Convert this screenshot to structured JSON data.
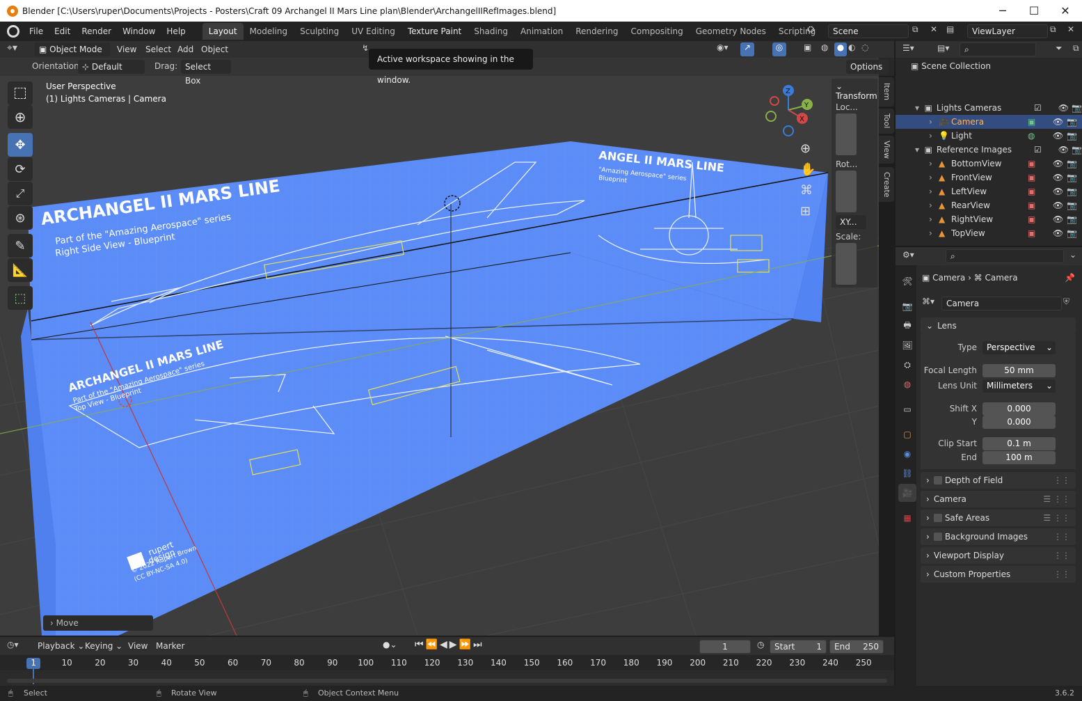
{
  "window": {
    "title": "Blender [C:\\Users\\ruper\\Documents\\Projects - Posters\\Craft 09 Archangel II Mars Line plan\\Blender\\ArchangelIIRefImages.blend]",
    "min": "─",
    "max": "☐",
    "close": "✕"
  },
  "menus": [
    "File",
    "Edit",
    "Render",
    "Window",
    "Help"
  ],
  "workspaces": [
    "Layout",
    "Modeling",
    "Sculpting",
    "UV Editing",
    "Texture Paint",
    "Shading",
    "Animation",
    "Rendering",
    "Compositing",
    "Geometry Nodes",
    "Scripting"
  ],
  "add_workspace": "+",
  "scene": {
    "label": "Scene",
    "viewlayer": "ViewLayer"
  },
  "header": {
    "mode": "Object Mode",
    "view": "View",
    "select": "Select",
    "add": "Add",
    "object": "Object",
    "orientation_label": "Orientation:",
    "orientation": "Default",
    "drag_label": "Drag:",
    "drag": "Select Box",
    "options": "Options"
  },
  "tooltip": "Active workspace showing in the window.",
  "viewport": {
    "line1": "User Perspective",
    "line2": "(1) Lights Cameras | Camera",
    "move_panel": "Move"
  },
  "npanel": {
    "title": "Transform",
    "loc": "Loc...",
    "rot": "Rot...",
    "rotmode": "XY...",
    "scale": "Scale:",
    "tabs": [
      "Item",
      "Tool",
      "View",
      "Create"
    ]
  },
  "outliner": {
    "root": "Scene Collection",
    "rows": [
      {
        "name": "Lights Cameras",
        "indent": 1
      },
      {
        "name": "Camera",
        "indent": 2
      },
      {
        "name": "Light",
        "indent": 2
      },
      {
        "name": "Reference Images",
        "indent": 1
      },
      {
        "name": "BottomView",
        "indent": 2
      },
      {
        "name": "FrontView",
        "indent": 2
      },
      {
        "name": "LeftView",
        "indent": 2
      },
      {
        "name": "RearView",
        "indent": 2
      },
      {
        "name": "RightView",
        "indent": 2
      },
      {
        "name": "TopView",
        "indent": 2
      }
    ]
  },
  "props": {
    "crumb1": "Camera",
    "crumb2": "Camera",
    "datablock": "Camera",
    "lens_panel": "Lens",
    "type_label": "Type",
    "type_val": "Perspective",
    "focal_label": "Focal Length",
    "focal_val": "50 mm",
    "unit_label": "Lens Unit",
    "unit_val": "Millimeters",
    "shiftx_label": "Shift X",
    "shiftx_val": "0.000",
    "shifty_label": "Y",
    "shifty_val": "0.000",
    "clipstart_label": "Clip Start",
    "clipstart_val": "0.1 m",
    "clipend_label": "End",
    "clipend_val": "100 m",
    "panels": [
      "Depth of Field",
      "Camera",
      "Safe Areas",
      "Background Images",
      "Viewport Display",
      "Custom Properties"
    ]
  },
  "timeline": {
    "playback": "Playback",
    "keying": "Keying",
    "view": "View",
    "marker": "Marker",
    "frame": "1",
    "start_label": "Start",
    "start": "1",
    "end_label": "End",
    "end": "250",
    "ticks": [
      "1",
      "10",
      "20",
      "30",
      "40",
      "50",
      "60",
      "70",
      "80",
      "90",
      "100",
      "110",
      "120",
      "130",
      "140",
      "150",
      "160",
      "170",
      "180",
      "190",
      "200",
      "210",
      "220",
      "230",
      "240",
      "250"
    ]
  },
  "status": {
    "select": "Select",
    "rotate": "Rotate View",
    "context": "Object Context Menu",
    "version": "3.6.2"
  },
  "blueprint": {
    "title_right": "ARCHANGEL II MARS LINE",
    "sub_right": "Part of the \"Amazing Aerospace\" series",
    "sub_right2": "Right Side View - Blueprint",
    "title_top": "ARCHANGEL II MARS LINE",
    "sub_top": "Part of the \"Amazing Aerospace\" series",
    "sub_top2": "Top View - Blueprint",
    "title_front": "ANGEL II MARS LINE",
    "sub_front": "\"Amazing Aerospace\" series",
    "sub_front2": "Blueprint",
    "credit1": "rupert",
    "credit2": "design",
    "credit3": "© 2022 Rupert Brown",
    "credit4": "(CC BY-NC-SA 4.0)"
  }
}
